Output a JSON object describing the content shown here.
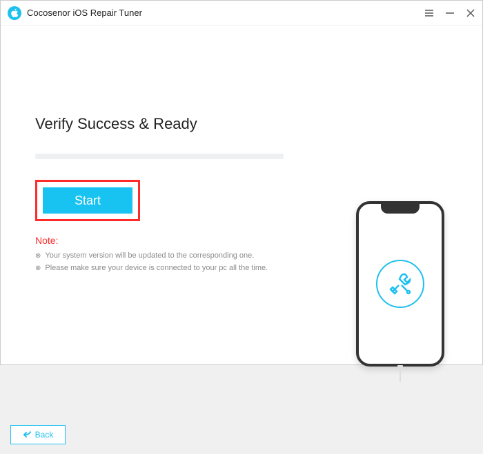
{
  "app": {
    "title": "Cocosenor iOS Repair Tuner"
  },
  "main": {
    "heading": "Verify Success & Ready",
    "start_label": "Start",
    "note_label": "Note:",
    "notes": [
      "Your system version will be updated to the corresponding one.",
      "Please make sure your device is connected to your pc all the time."
    ]
  },
  "footer": {
    "back_label": "Back"
  },
  "colors": {
    "accent": "#1ec0f0",
    "highlight_border": "#ff2a2a"
  }
}
